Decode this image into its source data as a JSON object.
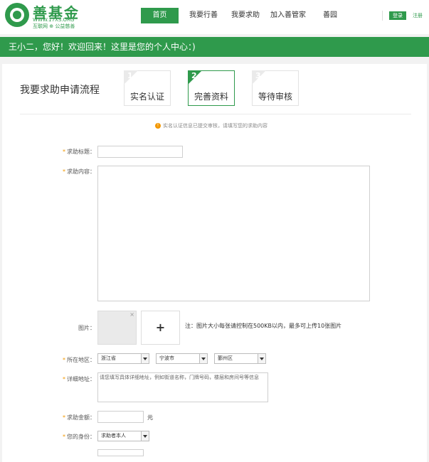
{
  "logo": {
    "title": "善基金",
    "url": "WWW.17XS.ORG",
    "sub": "互联网 ⊕ 公益慈善"
  },
  "nav": {
    "items": [
      {
        "label": "首页",
        "active": true
      },
      {
        "label": "我要行善",
        "active": false
      },
      {
        "label": "我要求助",
        "active": false
      },
      {
        "label": "加入善管家",
        "active": false
      },
      {
        "label": "善园",
        "active": false
      }
    ],
    "login": "登录",
    "register": "注册"
  },
  "banner": {
    "text": "王小二，您好！欢迎回来！这里是您的个人中心：)"
  },
  "process": {
    "title": "我要求助申请流程",
    "steps": [
      {
        "num": "1",
        "label": "实名认证",
        "active": false
      },
      {
        "num": "2",
        "label": "完善资料",
        "active": true
      },
      {
        "num": "3",
        "label": "等待审核",
        "active": false
      }
    ]
  },
  "notice": {
    "text": "实名认证信息已提交审核，请填写您的求助内容"
  },
  "form": {
    "title_label": "求助标题：",
    "title_value": "",
    "content_label": "求助内容：",
    "content_value": "",
    "image_label": "图片：",
    "image_add": "+",
    "image_remove": "×",
    "image_note": "注：图片大小每张请控制在500KB以内，最多可上传10张图片",
    "region_label": "所在地区：",
    "province": "浙江省",
    "city": "宁波市",
    "district": "鄞州区",
    "address_label": "详细地址：",
    "address_value": "请您填写具体详细地址，例如街道名称，门牌号码，楼层和房间号等信息",
    "amount_label": "求助金额：",
    "amount_unit": "元",
    "identity_label": "您的身份：",
    "identity_value": "求助者本人",
    "required_mark": "*"
  },
  "colors": {
    "brand": "#2f9a4c",
    "accent": "#f39800"
  }
}
